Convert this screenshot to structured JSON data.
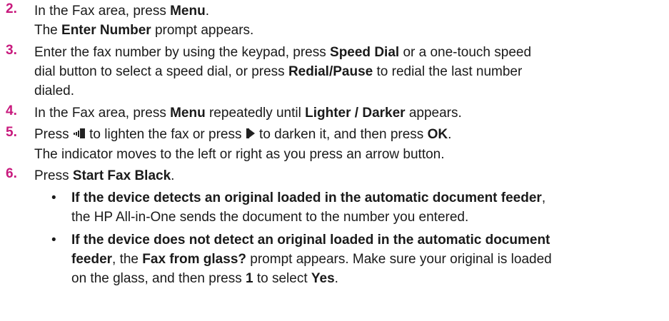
{
  "steps": [
    {
      "num": "2.",
      "a": "In the Fax area, press ",
      "b": "Menu",
      "c": ".",
      "sub_b": "Enter Number",
      "sub_c": " prompt appears.",
      "sub_a": "The "
    },
    {
      "num": "3.",
      "l1_a": "Enter the fax number by using the keypad, press ",
      "l1_b": "Speed Dial",
      "l1_c": " or a one-touch speed",
      "l2_a": "dial button to select a speed dial, or press ",
      "l2_b": "Redial/Pause",
      "l2_c": " to redial the last number",
      "l3": "dialed."
    },
    {
      "num": "4.",
      "a": "In the Fax area, press ",
      "b": "Menu",
      "c": " repeatedly until ",
      "d": "Lighter / Darker",
      "e": " appears."
    },
    {
      "num": "5.",
      "a": "Press ",
      "b": " to lighten the fax or press ",
      "c": " to darken it, and then press ",
      "d": "OK",
      "e": ".",
      "sub": "The indicator moves to the left or right as you press an arrow button."
    },
    {
      "num": "6.",
      "a": "Press ",
      "b": "Start Fax Black",
      "c": "."
    }
  ],
  "bullets": [
    {
      "mark": "•",
      "l1_b": "If the device detects an original loaded in the automatic document feeder",
      "l1_c": ",",
      "l2": "the HP All-in-One sends the document to the number you entered."
    },
    {
      "mark": "•",
      "l1_b": "If the device does not detect an original loaded in the automatic document",
      "l2_b": "feeder",
      "l2_c": ", the ",
      "l2_d": "Fax from glass?",
      "l2_e": " prompt appears. Make sure your original is loaded",
      "l3_a": "on the glass, and then press ",
      "l3_b": "1",
      "l3_c": " to select ",
      "l3_d": "Yes",
      "l3_e": "."
    }
  ],
  "colors": {
    "step_number": "#c8197d",
    "text": "#1a1a1a"
  },
  "icons": {
    "left_arrow": "left-arrow-button-icon",
    "right_arrow": "right-arrow-button-icon"
  }
}
